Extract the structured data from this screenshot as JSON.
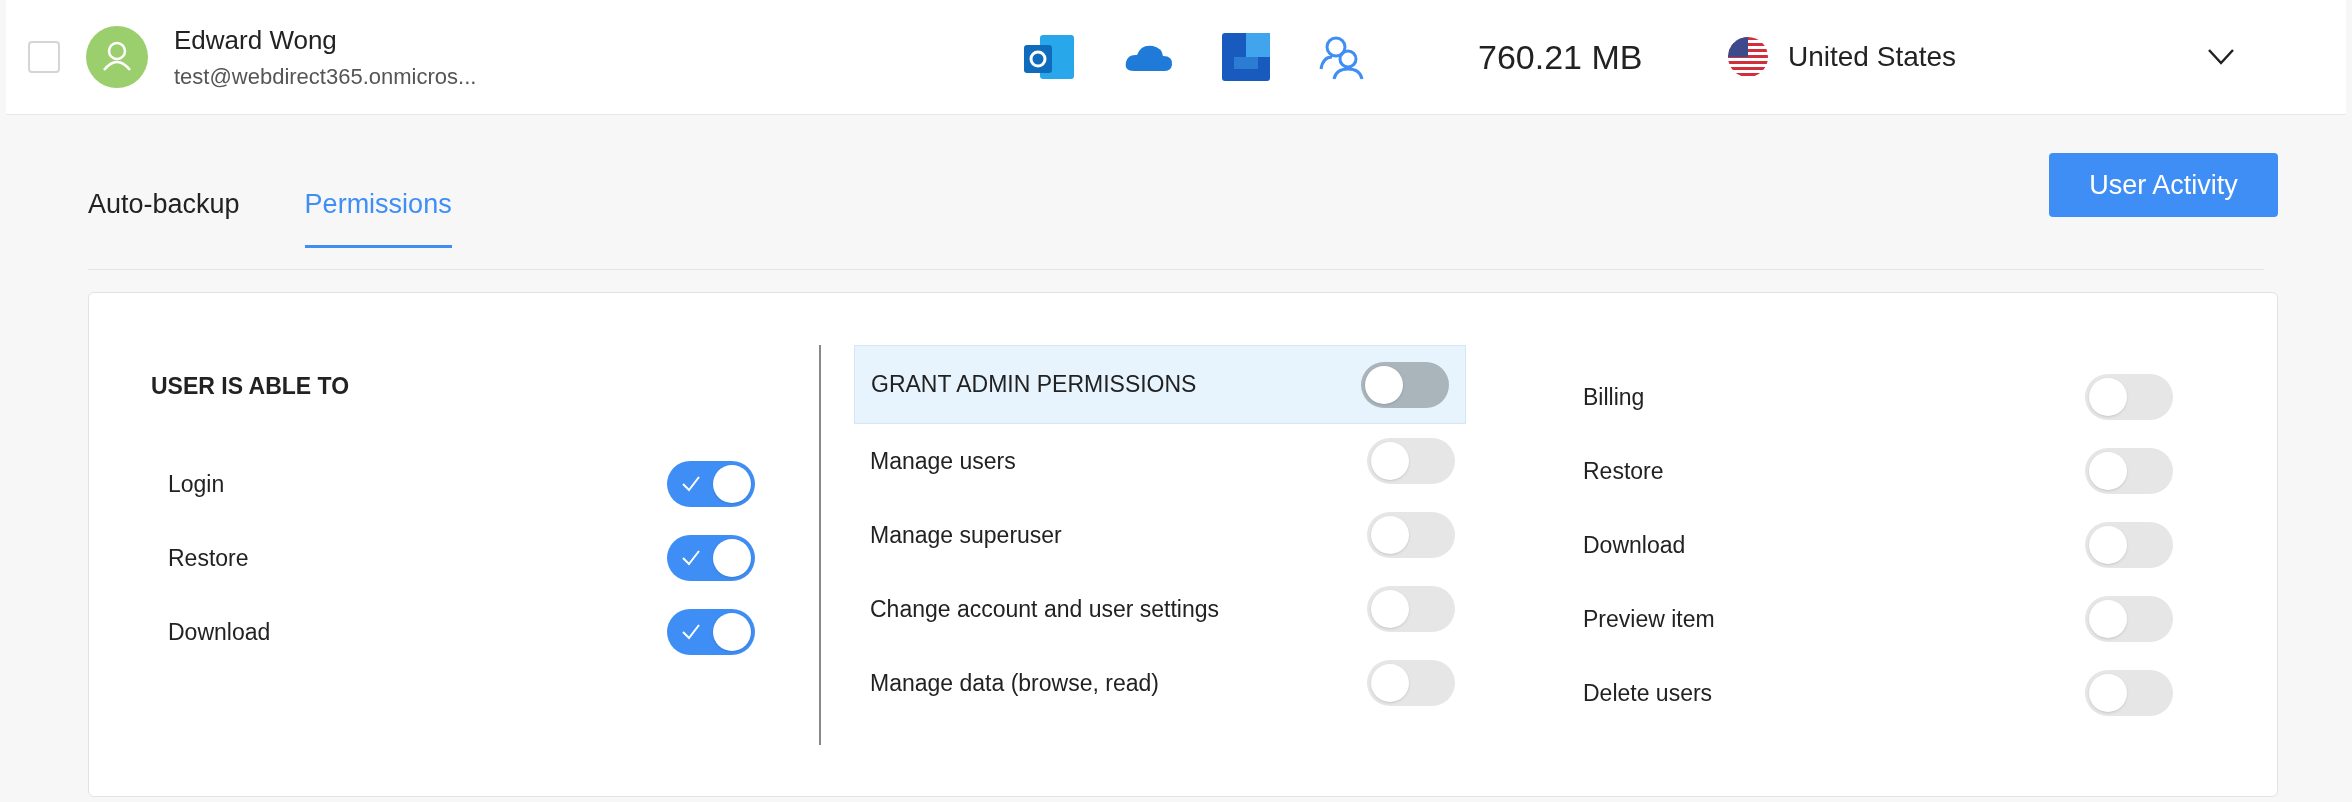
{
  "user": {
    "selected": false,
    "name": "Edward Wong",
    "email": "test@webdirect365.onmicros...",
    "storage": "760.21 MB",
    "country": "United States",
    "expanded": false
  },
  "tabs": [
    {
      "label": "Auto-backup",
      "selected": false
    },
    {
      "label": "Permissions",
      "selected": true
    }
  ],
  "activity_button": "User Activity",
  "user_permissions": {
    "heading": "USER IS ABLE TO",
    "items": [
      {
        "label": "Login",
        "on": true
      },
      {
        "label": "Restore",
        "on": true
      },
      {
        "label": "Download",
        "on": true
      }
    ]
  },
  "admin": {
    "label": "GRANT ADMIN PERMISSIONS",
    "on": false
  },
  "admin_permissions": [
    {
      "label": "Manage users",
      "on": false
    },
    {
      "label": "Manage superuser",
      "on": false
    },
    {
      "label": "Change account and user settings",
      "on": false
    },
    {
      "label": "Manage data (browse, read)",
      "on": false
    }
  ],
  "admin_permissions_2": [
    {
      "label": "Billing",
      "on": false
    },
    {
      "label": "Restore",
      "on": false
    },
    {
      "label": "Download",
      "on": false
    },
    {
      "label": "Preview item",
      "on": false
    },
    {
      "label": "Delete users",
      "on": false
    }
  ]
}
